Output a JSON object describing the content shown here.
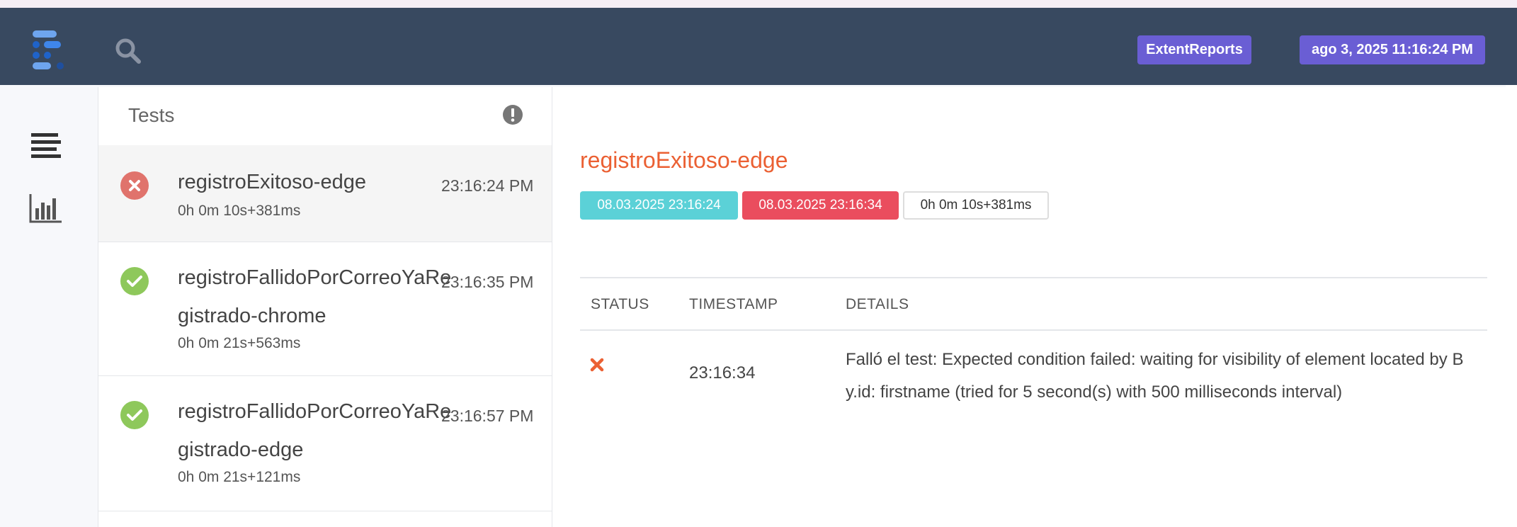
{
  "header": {
    "brand_badge": "ExtentReports",
    "date_badge": "ago 3, 2025 11:16:24 PM"
  },
  "colors": {
    "navbar": "#384960",
    "badge": "#6a5ed4",
    "fail": "#e0736c",
    "pass": "#8ec85b",
    "title": "#eb6033",
    "start_chip": "#5bd1d7",
    "end_chip": "#ea4d5e"
  },
  "icons": {
    "logo": "extent-logo-icon",
    "search": "search-icon",
    "dashboard": "list-lines-icon",
    "stats": "bar-chart-icon",
    "alert": "exclamation-circle-icon",
    "fail": "x-circle-icon",
    "pass": "check-circle-icon",
    "log_fail": "x-mark-icon"
  },
  "panel": {
    "title": "Tests"
  },
  "tests": [
    {
      "name": "registroExitoso-edge",
      "time": "23:16:24 PM",
      "duration": "0h 0m 10s+381ms",
      "status": "fail"
    },
    {
      "name": "registroFallidoPorCorreoYaRegistrado-chrome",
      "time": "23:16:35 PM",
      "duration": "0h 0m 21s+563ms",
      "status": "pass"
    },
    {
      "name": "registroFallidoPorCorreoYaRegistrado-edge",
      "time": "23:16:57 PM",
      "duration": "0h 0m 21s+121ms",
      "status": "pass"
    }
  ],
  "detail": {
    "title": "registroExitoso-edge",
    "start": "08.03.2025 23:16:24",
    "end": "08.03.2025 23:16:34",
    "duration": "0h 0m 10s+381ms",
    "columns": [
      "STATUS",
      "TIMESTAMP",
      "DETAILS"
    ],
    "logs": [
      {
        "status": "fail",
        "timestamp": "23:16:34",
        "details": "Falló el test: Expected condition failed: waiting for visibility of element located by By.id: firstname (tried for 5 second(s) with 500 milliseconds interval)"
      }
    ]
  }
}
